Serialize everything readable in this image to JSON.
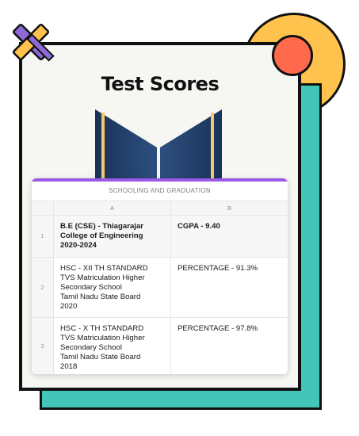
{
  "page": {
    "title": "Test Scores"
  },
  "colors": {
    "accent_purple": "#9b58e6",
    "circle_yellow": "#ffc34d",
    "circle_red": "#ff6a4d",
    "teal": "#43c6b8",
    "book_navy": "#1f3a63",
    "book_gold": "#f5c86b"
  },
  "sheet": {
    "title": "SCHOOLING AND GRADUATION",
    "columns": [
      "A",
      "B"
    ],
    "rows": [
      {
        "num": "1",
        "a": "B.E (CSE) - Thiagarajar\nCollege of Engineering\n2020-2024",
        "b": "CGPA - 9.40"
      },
      {
        "num": "2",
        "a": "HSC - XII TH STANDARD\nTVS Matriculation Higher\nSecondary School\nTamil Nadu State Board\n2020",
        "b": "PERCENTAGE - 91.3%"
      },
      {
        "num": "3",
        "a": "HSC - X TH STANDARD\nTVS Matriculation Higher\nSecondary School\nTamil Nadu State Board\n2018",
        "b": "PERCENTAGE - 97.8%"
      }
    ]
  }
}
